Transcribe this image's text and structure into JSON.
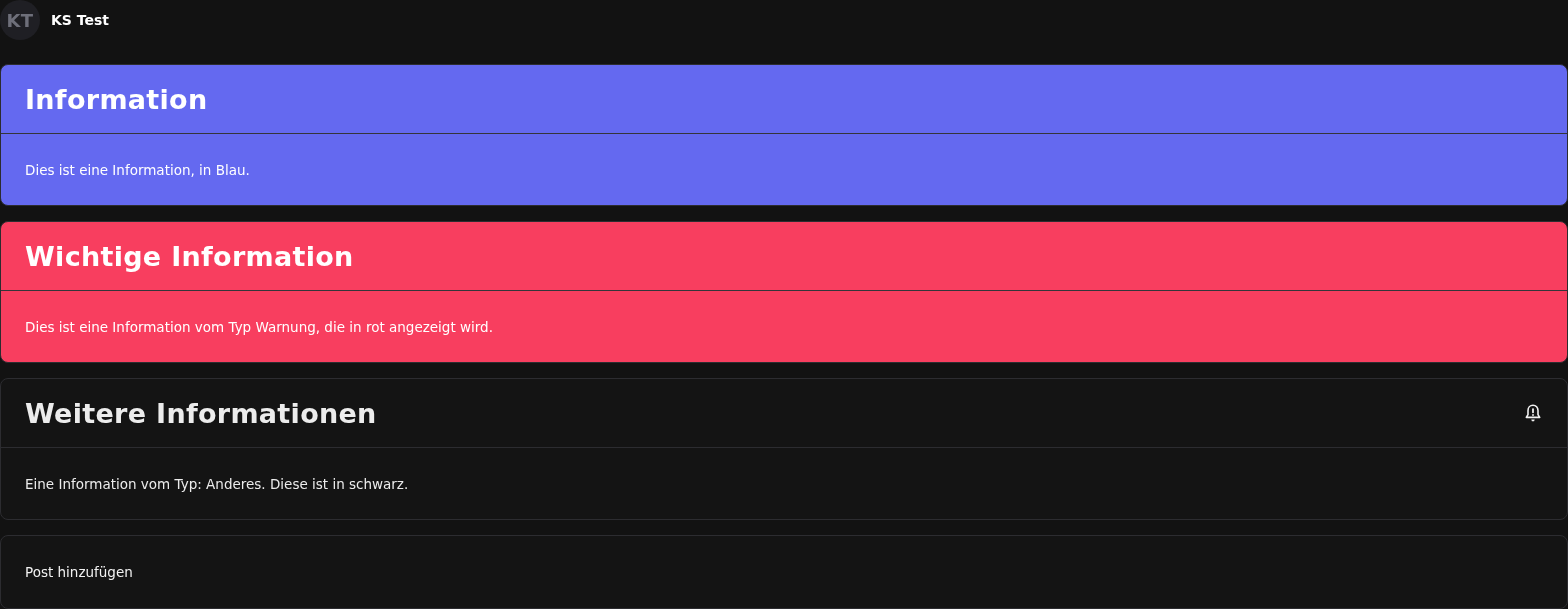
{
  "user": {
    "initials": "KT",
    "name": "KS Test"
  },
  "notices": [
    {
      "kind": "info",
      "title": "Information",
      "text": "Dies ist eine Information, in Blau."
    },
    {
      "kind": "warning",
      "title": "Wichtige Information",
      "text": "Dies ist eine Information vom Typ Warnung, die in rot angezeigt wird."
    },
    {
      "kind": "other",
      "title": "Weitere Informationen",
      "text": "Eine Information vom Typ: Anderes. Diese ist in schwarz."
    }
  ],
  "add_post": {
    "label": "Post hinzufügen"
  }
}
